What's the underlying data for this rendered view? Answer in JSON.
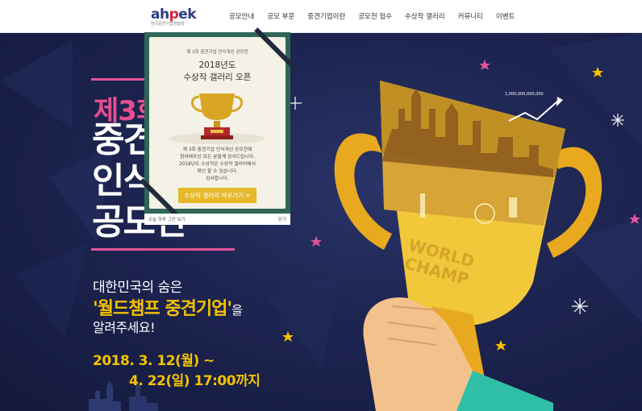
{
  "header": {
    "logo_text_a": "ah",
    "logo_text_p": "p",
    "logo_text_b": "ek",
    "logo_sub": "한국중견기업연합회",
    "nav": [
      {
        "label": "공모안내"
      },
      {
        "label": "공모 부문"
      },
      {
        "label": "중견기업이란"
      },
      {
        "label": "공모전 접수"
      },
      {
        "label": "수상작 갤러리"
      },
      {
        "label": "커뮤니티"
      },
      {
        "label": "이벤트"
      }
    ]
  },
  "hero": {
    "title_line1": "제3회",
    "title_line2": "중견",
    "title_line3": "인식",
    "title_line4": "공모전",
    "sub1": "대한민국의 숨은",
    "sub2_highlight": "'월드챔프 중견기업'",
    "sub2_rest": "을",
    "sub3": "알려주세요!",
    "date1": "2018. 3. 12(월) ~",
    "date2": "4. 22(일) 17:00까지",
    "trophy_text1": "WORLD",
    "trophy_text2": "CHAMP",
    "trophy_amount": "1,000,000,000,000"
  },
  "popup": {
    "small_title": "제 3회 중견기업 인식개선 공모전",
    "title_line1": "2018년도",
    "title_line2": "수상작 갤러리 오픈",
    "body_line1": "제 3회 중견기업 인식개선 공모전에",
    "body_line2": "참여해주신 모든 분들께 감사드립니다.",
    "body_line3": "2018년도 수상작은 수상작 갤러리에서",
    "body_line4": "확인 할 수 있습니다.",
    "body_line5": "감사합니다.",
    "button_label": "수상작 갤러리 바로가기 >",
    "footer_left": "오늘 하루 그만 보기",
    "footer_right": "닫기"
  },
  "colors": {
    "accent_pink": "#e3549a",
    "accent_yellow": "#f5c200",
    "popup_green": "#2f6658",
    "background": "#1d2450"
  }
}
